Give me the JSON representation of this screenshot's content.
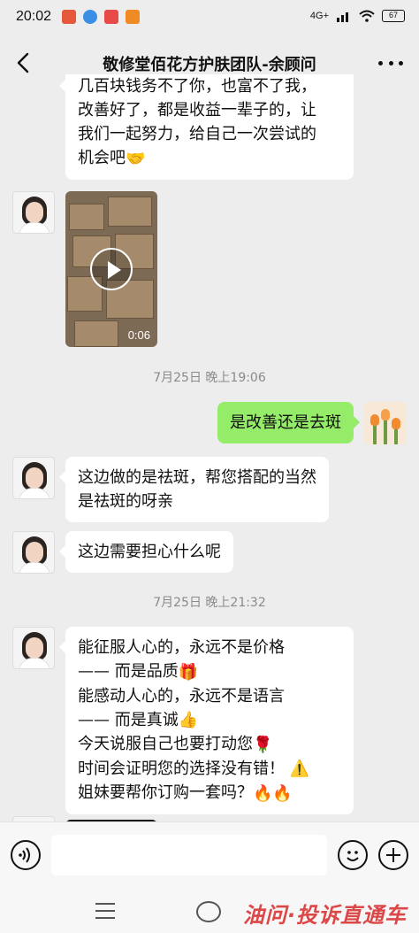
{
  "status_bar": {
    "time": "20:02",
    "network": "4G+",
    "battery": "67"
  },
  "header": {
    "title": "敬修堂佰花方护肤团队-余顾问"
  },
  "messages": {
    "m1": {
      "lines": [
        "几百块钱务不了你，也富不了我，",
        "改善好了，都是收益一辈子的，让",
        "我们一起努力，给自己一次尝试的",
        "机会吧"
      ],
      "emoji": "🤝"
    },
    "video": {
      "duration": "0:06"
    },
    "ts1": "7月25日 晚上19:06",
    "m2": {
      "text": "是改善还是去斑"
    },
    "m3": {
      "lines": [
        "这边做的是祛斑，帮您搭配的当然",
        "是祛斑的呀亲"
      ]
    },
    "m4": {
      "text": "这边需要担心什么呢"
    },
    "ts2": "7月25日 晚上21:32",
    "m5": {
      "l1": " 能征服人心的，永远不是价格",
      "l2": "—— 而是品质",
      "l2_emoji": "🎁",
      "l3": "能感动人心的，永远不是语言",
      "l4": "—— 而是真诚",
      "l4_emoji": "👍",
      "l5": "今天说服自己也要打动您",
      "l5_emoji": "🌹",
      "l6": "时间会证明您的选择没有错！",
      "l6_emoji": "⚠️",
      "l7": "姐妹要帮你订购一套吗？",
      "l7_emoji": "🔥🔥"
    }
  },
  "watermark": "油问·投诉直通车"
}
